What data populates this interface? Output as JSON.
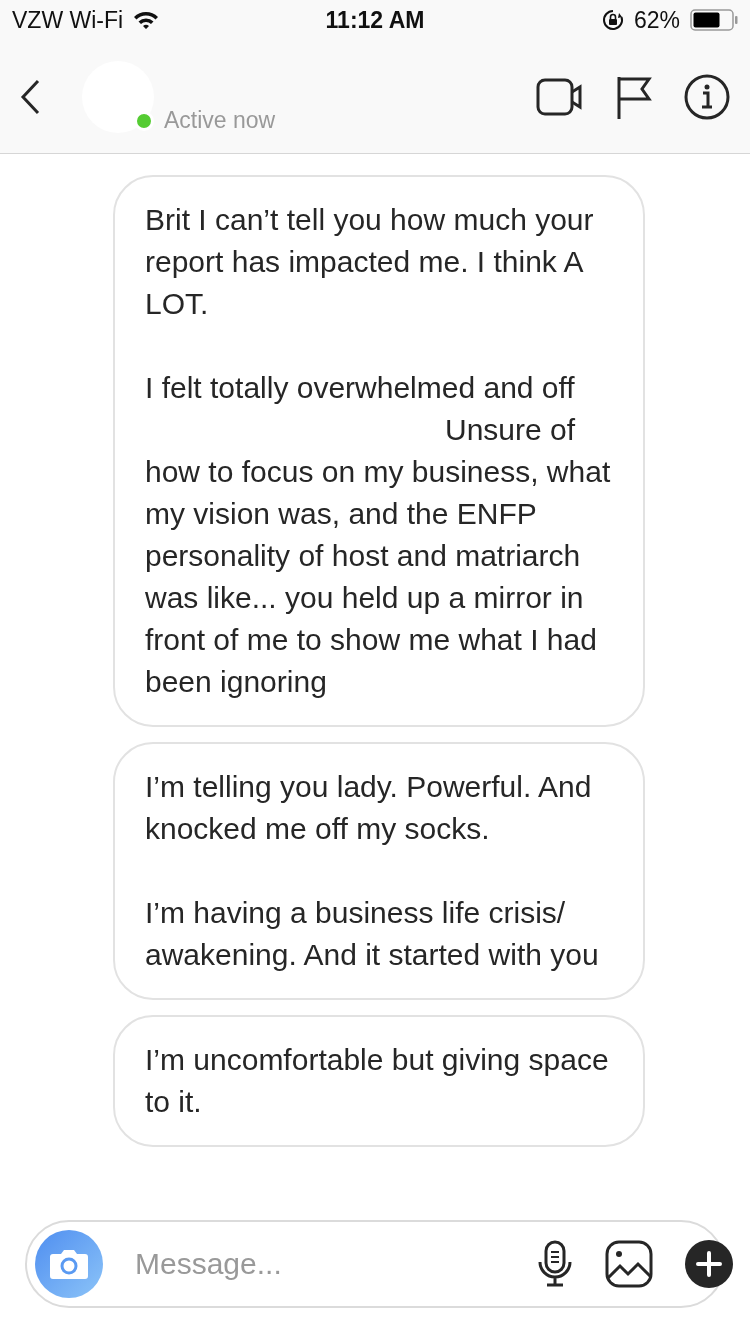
{
  "status_bar": {
    "carrier": "VZW Wi-Fi",
    "time": "11:12 AM",
    "battery": "62%"
  },
  "header": {
    "status": "Active now",
    "online": true
  },
  "messages": [
    {
      "paragraphs": [
        [
          {
            "kind": "text",
            "text": "Brit I can’t tell you how much your report has impacted me. I think A LOT."
          }
        ],
        [
          {
            "kind": "text",
            "text": "I felt totally overwhelmed and off"
          },
          {
            "kind": "redacted"
          },
          {
            "kind": "text",
            "text": "Unsure of how to focus on my business, what my vision was, and the ENFP personality of host and matriarch was like... you held up a mirror in front of me to show me what I had been ignoring"
          }
        ]
      ]
    },
    {
      "paragraphs": [
        [
          {
            "kind": "text",
            "text": "I’m telling you lady. Powerful. And knocked me off my socks."
          }
        ],
        [
          {
            "kind": "text",
            "text": "I’m having a business life crisis/ awakening. And it started with you"
          }
        ]
      ]
    },
    {
      "paragraphs": [
        [
          {
            "kind": "text",
            "text": "I’m uncomfortable but giving space to it."
          }
        ]
      ]
    }
  ],
  "composer": {
    "placeholder": "Message..."
  }
}
